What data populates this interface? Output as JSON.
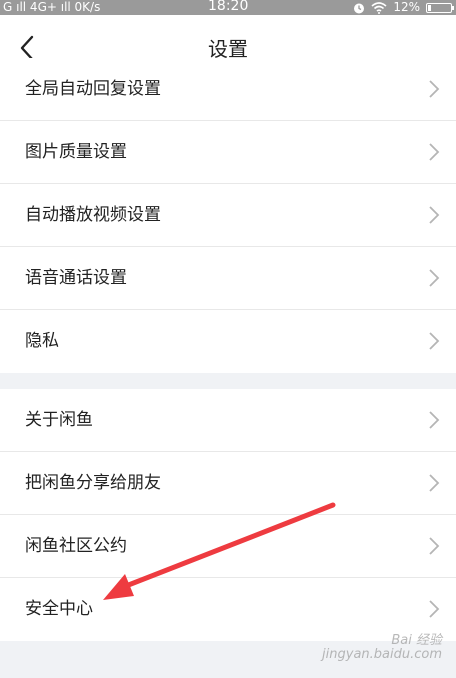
{
  "status_bar": {
    "left": "G ıll 4G+ ıll 0K/s",
    "time": "18:20",
    "battery": "12%",
    "battery_level": 0.12
  },
  "nav": {
    "title": "设置"
  },
  "group1": [
    {
      "label": "全局自动回复设置"
    },
    {
      "label": "图片质量设置"
    },
    {
      "label": "自动播放视频设置"
    },
    {
      "label": "语音通话设置"
    },
    {
      "label": "隐私"
    }
  ],
  "group2": [
    {
      "label": "关于闲鱼"
    },
    {
      "label": "把闲鱼分享给朋友"
    },
    {
      "label": "闲鱼社区公约"
    },
    {
      "label": "安全中心"
    }
  ],
  "watermark": "Bai 经验\njingyan.baidu.com",
  "colors": {
    "arrow": "#ee3b40",
    "chevron": "#b5b5b5",
    "background": "#f0f2f5"
  }
}
